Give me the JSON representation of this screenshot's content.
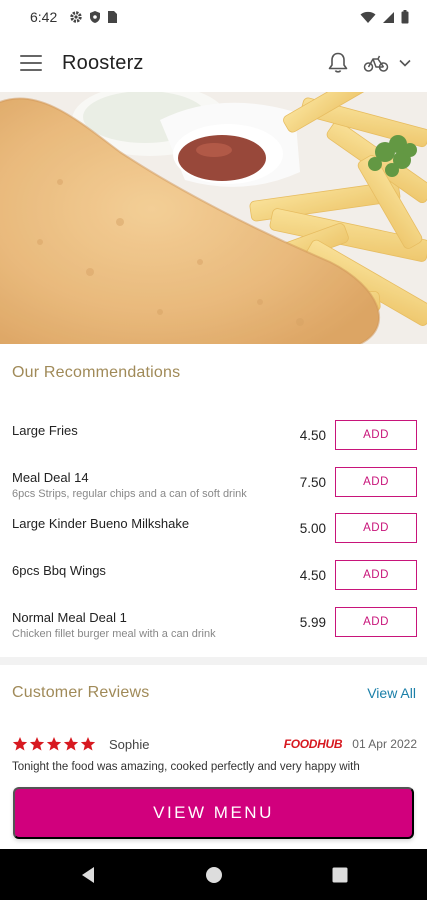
{
  "status_bar": {
    "time": "6:42"
  },
  "app_bar": {
    "title": "Roosterz"
  },
  "recommendations": {
    "heading": "Our Recommendations",
    "add_label": "ADD",
    "items": [
      {
        "name": "Large Fries",
        "description": "",
        "price": "4.50"
      },
      {
        "name": "Meal Deal 14",
        "description": "6pcs Strips, regular chips and a can of soft drink",
        "price": "7.50"
      },
      {
        "name": "Large Kinder Bueno Milkshake",
        "description": "",
        "price": "5.00"
      },
      {
        "name": "6pcs Bbq Wings",
        "description": "",
        "price": "4.50"
      },
      {
        "name": "Normal Meal Deal 1",
        "description": "Chicken fillet burger meal with a can drink",
        "price": "5.99"
      }
    ]
  },
  "reviews": {
    "heading": "Customer Reviews",
    "view_all": "View All",
    "items": [
      {
        "rating": 5,
        "reviewer": "Sophie",
        "source": "FOODHUB",
        "date": "01 Apr 2022",
        "text": "Tonight the food was amazing, cooked perfectly and very happy with"
      }
    ]
  },
  "cta": {
    "label": "VIEW MENU"
  },
  "colors": {
    "accent": "#d1007d",
    "heading": "#a08a58",
    "link": "#1a7fa8",
    "star": "#d71920"
  }
}
